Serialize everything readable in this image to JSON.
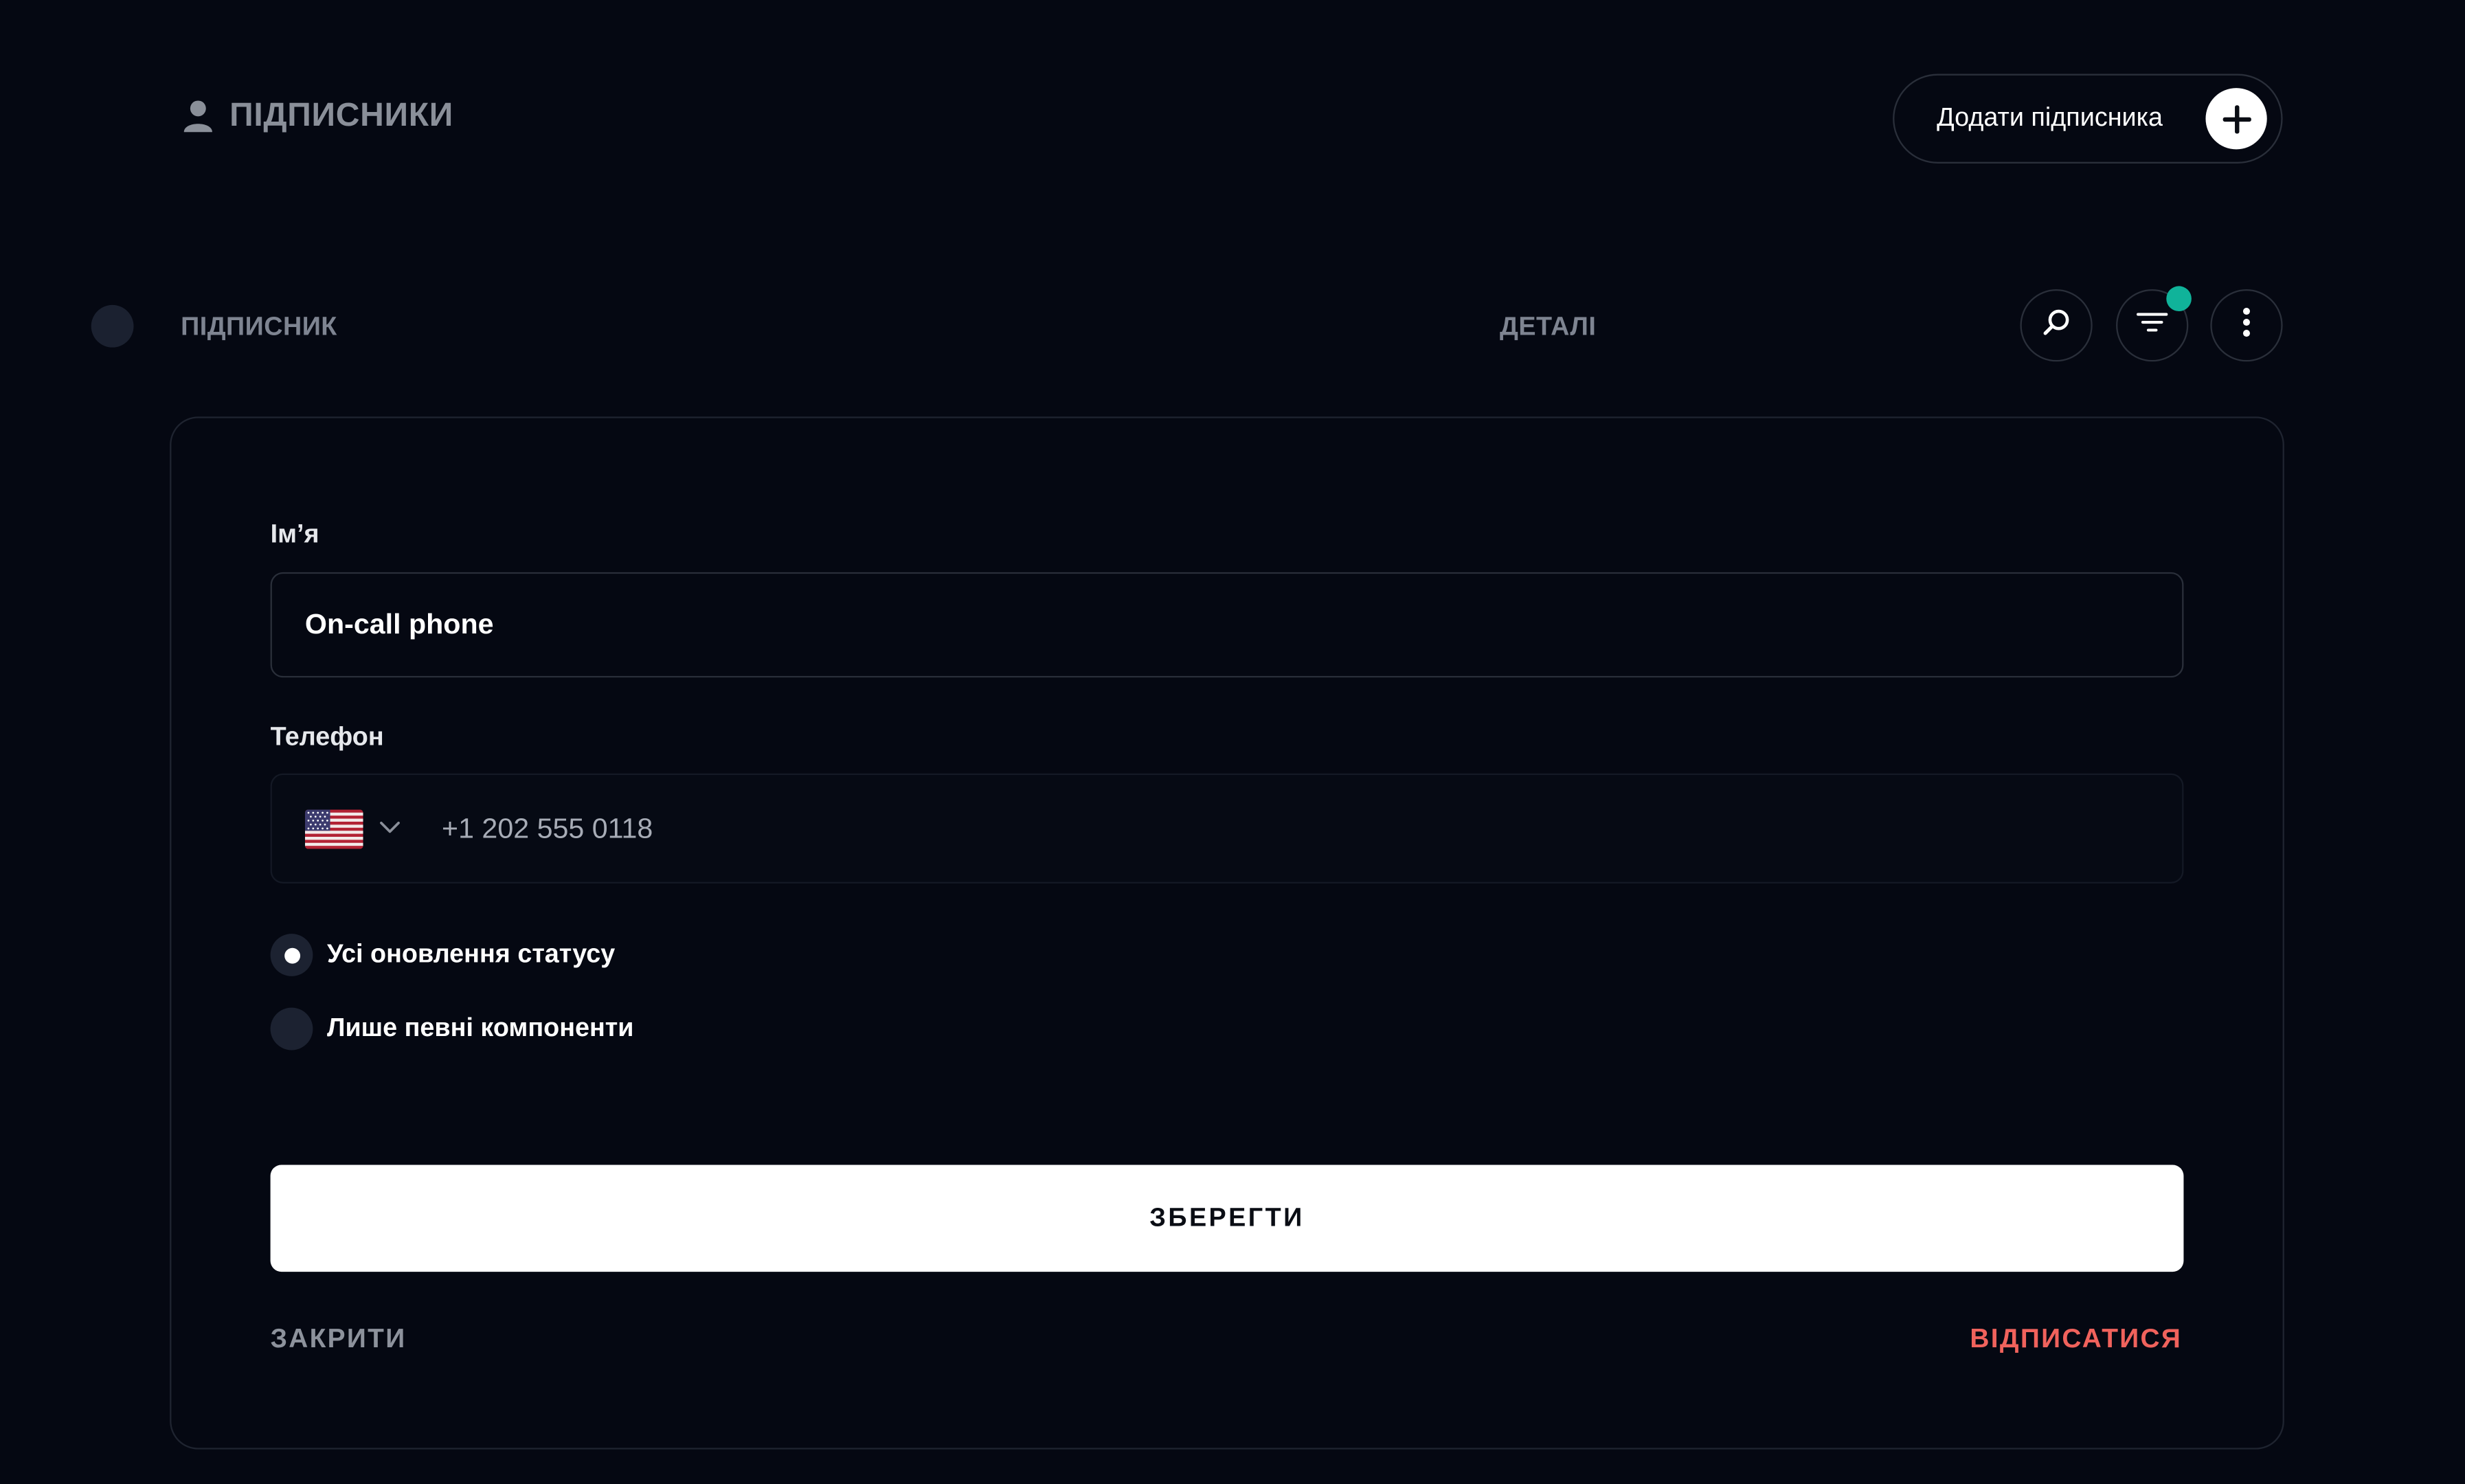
{
  "header": {
    "title": "ПІДПИСНИКИ",
    "add_button_label": "Додати підписника"
  },
  "table": {
    "columns": [
      "ПІДПИСНИК",
      "ДЕТАЛІ"
    ]
  },
  "filter": {
    "active_indicator_color": "#10b39a"
  },
  "form": {
    "name_label": "Ім’я",
    "name_value": "On-call phone",
    "phone_label": "Телефон",
    "country": "US",
    "phone_value": "+1 202 555 0118",
    "notification_options": [
      {
        "label": "Усі оновлення статусу",
        "selected": true
      },
      {
        "label": "Лише певні компоненти",
        "selected": false
      }
    ],
    "save_label": "ЗБЕРЕГТИ",
    "close_label": "ЗАКРИТИ",
    "unsubscribe_label": "ВІДПИСАТИСЯ"
  },
  "colors": {
    "background": "#050812",
    "danger": "#f0625c",
    "muted_text": "#8a8f99",
    "primary_button": "#ffffff"
  }
}
